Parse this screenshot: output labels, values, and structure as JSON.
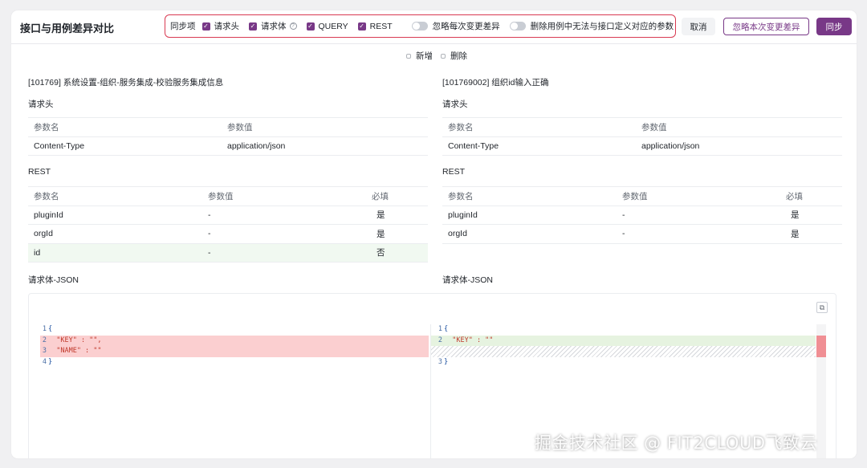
{
  "dialog": {
    "title": "接口与用例差异对比",
    "sync_label": "同步项",
    "options": [
      {
        "label": "请求头"
      },
      {
        "label": "请求体"
      },
      {
        "label": "QUERY"
      },
      {
        "label": "REST"
      }
    ],
    "ignore_switch": "忽略每次变更差异",
    "delete_switch": "删除用例中无法与接口定义对应的参数",
    "cancel_button": "取消",
    "ignore_button": "忽略本次变更差异",
    "sync_button": "同步",
    "checked_icon": "check-icon"
  },
  "legend": {
    "added": "新增",
    "deleted": "删除"
  },
  "left": {
    "case_name": "[101769] 系统设置-组织-服务集成-校验服务集成信息",
    "header_section": "请求头",
    "header_table": {
      "columns": [
        "参数名",
        "参数值"
      ],
      "rows": [
        [
          "Content-Type",
          "application/json"
        ]
      ]
    },
    "rest_section": "REST",
    "rest_table": {
      "columns": [
        "参数名",
        "参数值",
        "必填"
      ],
      "rows": [
        [
          "pluginId",
          "-",
          "是"
        ],
        [
          "orgId",
          "-",
          "是"
        ],
        [
          "id",
          "-",
          "否"
        ]
      ]
    },
    "json_section": "请求体-JSON"
  },
  "right": {
    "case_name": "[101769002] 组织id输入正确",
    "header_section": "请求头",
    "header_table": {
      "columns": [
        "参数名",
        "参数值"
      ],
      "rows": [
        [
          "Content-Type",
          "application/json"
        ]
      ]
    },
    "rest_section": "REST",
    "rest_table": {
      "columns": [
        "参数名",
        "参数值",
        "必填"
      ],
      "rows": [
        [
          "pluginId",
          "-",
          "是"
        ],
        [
          "orgId",
          "-",
          "是"
        ]
      ]
    },
    "json_section": "请求体-JSON"
  },
  "editor_left": {
    "lines": [
      {
        "n": "1",
        "text": "{"
      },
      {
        "n": "2",
        "text": "  \"KEY\" : \"\","
      },
      {
        "n": "3",
        "text": "  \"NAME\" : \"\""
      },
      {
        "n": "4",
        "text": "}"
      }
    ]
  },
  "editor_right": {
    "lines": [
      {
        "n": "1",
        "text": "{"
      },
      {
        "n": "2",
        "text": "  \"KEY\" : \"\""
      },
      {
        "n": "3",
        "text": "}"
      }
    ]
  },
  "copy_icon": "copy-icon",
  "colors": {
    "brand": "#783887",
    "deleted": "#fbcfd0",
    "added": "#e6f3e0",
    "highlight_border": "#d93a52"
  },
  "watermark": "掘金技术社区 @ FIT2CLOUD飞致云"
}
